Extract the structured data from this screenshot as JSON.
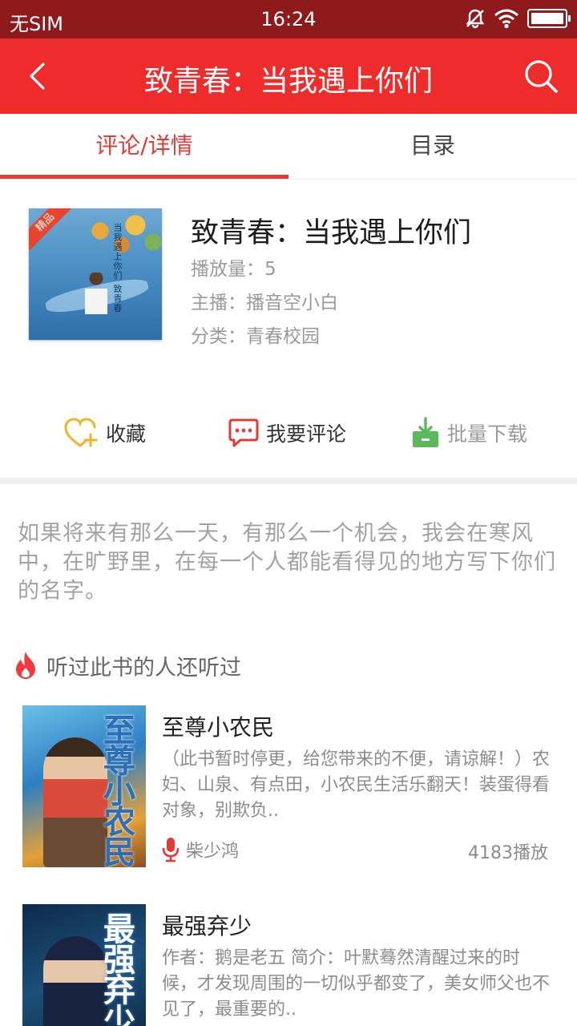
{
  "status_bar": {
    "carrier": "无SIM",
    "time": "16:24"
  },
  "header": {
    "title": "致青春：当我遇上你们"
  },
  "tabs": [
    {
      "label": "评论/详情",
      "active": true
    },
    {
      "label": "目录",
      "active": false
    }
  ],
  "book": {
    "badge": "精品",
    "cover_title": "当我遇上你们 致青春",
    "title": "致青春：当我遇上你们",
    "plays": "播放量：5",
    "host": "主播：播音空小白",
    "category": "分类：青春校园"
  },
  "actions": {
    "favorite": "收藏",
    "comment": "我要评论",
    "download": "批量下载"
  },
  "description": "如果将来有那么一天，有那么一个机会，我会在寒风中，在旷野里，在每一个人都能看得见的地方写下你们的名字。",
  "recommendations": {
    "header": "听过此书的人还听过",
    "items": [
      {
        "cover_text": "至尊小农民",
        "title": "至尊小农民",
        "desc": "（此书暂时停更，给您带来的不便，请谅解！）农妇、山泉、有点田，小农民生活乐翻天！装蛋得看对象，别欺负..",
        "author": "柴少鸿",
        "plays": "4183播放"
      },
      {
        "cover_text": "最强弃少",
        "title": "最强弃少",
        "desc": "作者：鹅是老五 简介：叶默蓦然清醒过来的时候，才发现周围的一切似乎都变了，美女师父也不见了，最重要的..",
        "author": "",
        "plays": ""
      }
    ]
  },
  "colors": {
    "brand_red": "#ef2c2c",
    "status_bar": "#8f1a1c",
    "accent_tab": "#e23a35",
    "favorite_icon": "#f0b429",
    "download_icon": "#5cb85c"
  }
}
